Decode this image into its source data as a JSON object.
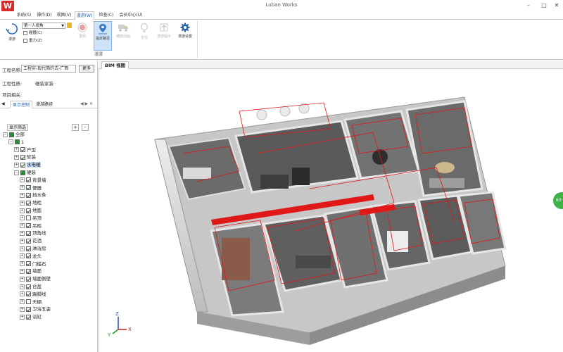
{
  "app": {
    "title": "Luban Works",
    "logo_letter": "W"
  },
  "window_controls": {
    "minimize": "–",
    "maximize": "□",
    "close": "✕"
  },
  "menu": {
    "tabs": [
      "系统(S)",
      "操作(D)",
      "视图(V)",
      "漫游(W)",
      "检查(C)",
      "会员中心(U)"
    ],
    "active_index": 3
  },
  "ribbon": {
    "roam_label": "漫游",
    "view_select": "第一人视角",
    "collision_label": "碰撞(C)",
    "gravity_label": "重力(Z)",
    "buttons": [
      {
        "label": "录制",
        "icon": "record-icon",
        "state": "disabled"
      },
      {
        "label": "指定路径",
        "icon": "path-pin-icon",
        "state": "selected"
      },
      {
        "label": "播放动画",
        "icon": "truck-icon",
        "state": "disabled"
      },
      {
        "label": "定位",
        "icon": "locate-icon",
        "state": "disabled"
      },
      {
        "label": "漫游提示",
        "icon": "hint-icon",
        "state": "disabled"
      },
      {
        "label": "漫游设置",
        "icon": "gear-icon",
        "state": "normal"
      }
    ],
    "group_label": "漫游"
  },
  "left_panel": {
    "project_name_label": "工程名称:",
    "project_name_value": "工程实-现代简约式-广西",
    "more_button": "更多",
    "project_type_label": "工程性质:",
    "project_type_value": "硬装家装",
    "project_related_label": "项目相关:",
    "tabs": [
      "显示控制",
      "漫游路径"
    ],
    "active_tab": 0,
    "filter_button": "显示筛选",
    "expand_all": "+",
    "collapse_all": "-",
    "tree": [
      {
        "label": "全部",
        "level": 0,
        "checked": "partial",
        "expanded": true
      },
      {
        "label": "1",
        "level": 1,
        "checked": "partial",
        "expanded": true
      },
      {
        "label": "户型",
        "level": 2,
        "checked": "on",
        "expanded": false
      },
      {
        "label": "软装",
        "level": 2,
        "checked": "on",
        "expanded": false
      },
      {
        "label": "水电暖",
        "level": 2,
        "checked": "on",
        "expanded": false,
        "highlight": true
      },
      {
        "label": "硬装",
        "level": 2,
        "checked": "partial",
        "expanded": true
      },
      {
        "label": "背景墙",
        "level": 3,
        "checked": "on"
      },
      {
        "label": "便器",
        "level": 3,
        "checked": "on"
      },
      {
        "label": "挡水条",
        "level": 3,
        "checked": "on"
      },
      {
        "label": "地柜",
        "level": 3,
        "checked": "on"
      },
      {
        "label": "地面",
        "level": 3,
        "checked": "on"
      },
      {
        "label": "吊顶",
        "level": 3,
        "checked": "off"
      },
      {
        "label": "吊柜",
        "level": 3,
        "checked": "on"
      },
      {
        "label": "顶角线",
        "level": 3,
        "checked": "on"
      },
      {
        "label": "花洒",
        "level": 3,
        "checked": "on"
      },
      {
        "label": "淋浴房",
        "level": 3,
        "checked": "on"
      },
      {
        "label": "龙头",
        "level": 3,
        "checked": "on"
      },
      {
        "label": "门槛石",
        "level": 3,
        "checked": "on"
      },
      {
        "label": "墙面",
        "level": 3,
        "checked": "on"
      },
      {
        "label": "墙面侧壁",
        "level": 3,
        "checked": "on"
      },
      {
        "label": "台盆",
        "level": 3,
        "checked": "on"
      },
      {
        "label": "踢脚线",
        "level": 3,
        "checked": "on"
      },
      {
        "label": "天棚",
        "level": 3,
        "checked": "off"
      },
      {
        "label": "卫浴五金",
        "level": 3,
        "checked": "on"
      },
      {
        "label": "浴缸",
        "level": 3,
        "checked": "on"
      }
    ]
  },
  "view": {
    "tab_label": "BIM 视图",
    "axis_x": "X",
    "axis_y": "Y",
    "axis_z": "Z",
    "badge_text": "63"
  },
  "colors": {
    "accent": "#1a5fb4",
    "brand": "#d42a2a",
    "badge": "#3fb24a",
    "path": "#e01818"
  }
}
